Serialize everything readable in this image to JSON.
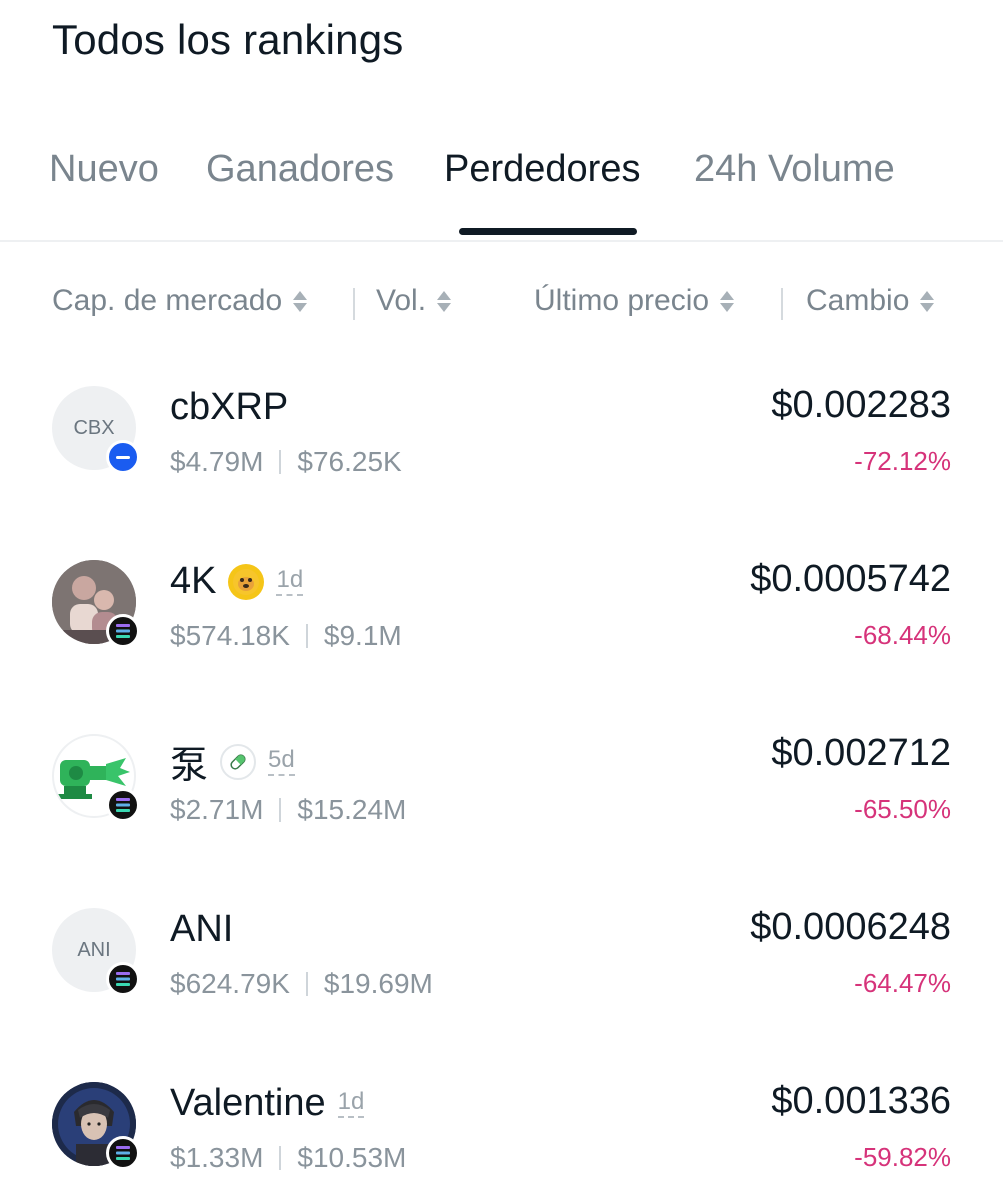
{
  "header": {
    "title": "Todos los rankings"
  },
  "tabs": [
    {
      "label": "Nuevo",
      "active": false
    },
    {
      "label": "Ganadores",
      "active": false
    },
    {
      "label": "Perdedores",
      "active": true
    },
    {
      "label": "24h Volume",
      "active": false
    }
  ],
  "sort": {
    "market_cap": "Cap. de mercado",
    "volume": "Vol.",
    "last_price": "Último precio",
    "change": "Cambio"
  },
  "colors": {
    "negative": "#d6337a",
    "text_primary": "#0f1a24",
    "text_secondary": "#8a949c",
    "base_chain": "#1a5cf0",
    "solana_chain": "#111111"
  },
  "tokens": [
    {
      "name": "cbXRP",
      "avatar_text": "CBX",
      "chain": "base-icon",
      "tag_icon": "",
      "age": "",
      "market_cap": "$4.79M",
      "volume": "$76.25K",
      "price": "$0.002283",
      "change": "-72.12%"
    },
    {
      "name": "4K",
      "avatar_text": "",
      "chain": "solana-icon",
      "tag_icon": "doge-emoji-icon",
      "age": "1d",
      "market_cap": "$574.18K",
      "volume": "$9.1M",
      "price": "$0.0005742",
      "change": "-68.44%"
    },
    {
      "name": "泵",
      "avatar_text": "",
      "chain": "solana-icon",
      "tag_icon": "pill-icon",
      "age": "5d",
      "market_cap": "$2.71M",
      "volume": "$15.24M",
      "price": "$0.002712",
      "change": "-65.50%"
    },
    {
      "name": "ANI",
      "avatar_text": "ANI",
      "chain": "solana-icon",
      "tag_icon": "",
      "age": "",
      "market_cap": "$624.79K",
      "volume": "$19.69M",
      "price": "$0.0006248",
      "change": "-64.47%"
    },
    {
      "name": "Valentine",
      "avatar_text": "",
      "chain": "solana-icon",
      "tag_icon": "",
      "age": "1d",
      "market_cap": "$1.33M",
      "volume": "$10.53M",
      "price": "$0.001336",
      "change": "-59.82%"
    }
  ]
}
